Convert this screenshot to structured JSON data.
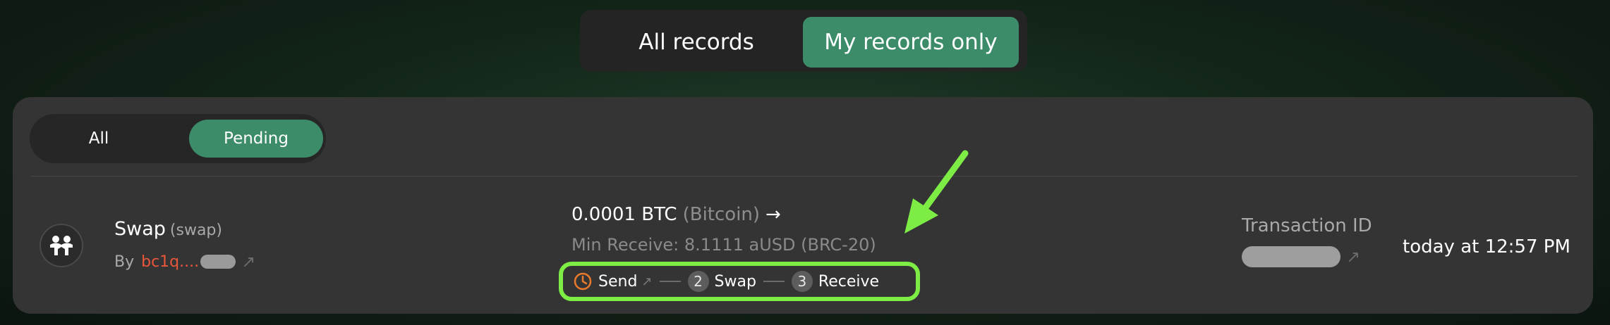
{
  "scope_toggle": {
    "all_label": "All records",
    "mine_label": "My records only",
    "active": "mine"
  },
  "filter": {
    "all_label": "All",
    "pending_label": "Pending",
    "active": "pending"
  },
  "record": {
    "icon": "users-icon",
    "title": "Swap",
    "subtitle": "(swap)",
    "by_label": "By",
    "address": "bc1q....",
    "amount": "0.0001 BTC",
    "network": "(Bitcoin)",
    "min_receive": "Min Receive: 8.1111 aUSD (BRC-20)",
    "steps": [
      {
        "label": "Send",
        "marker": "clock-icon"
      },
      {
        "label": "Swap",
        "marker": "2"
      },
      {
        "label": "Receive",
        "marker": "3"
      }
    ],
    "tx_label": "Transaction ID",
    "timestamp": "today at 12:57 PM"
  },
  "colors": {
    "accent": "#3c8c6a",
    "address": "#e8573a",
    "highlight": "#7dec45",
    "clock": "#ea7a2b"
  }
}
